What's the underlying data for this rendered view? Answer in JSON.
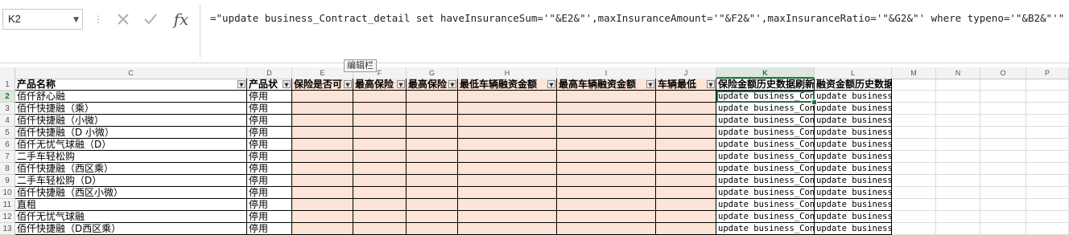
{
  "namebox": {
    "value": "K2"
  },
  "formula_bar": {
    "separator": "⋮",
    "insert_function_label": "fx",
    "formula": "=\"update business_Contract_detail set haveInsuranceSum='\"&E2&\"',maxInsuranceAmount='\"&F2&\"',maxInsuranceRatio='\"&G2&\"' where typeno='\"&B2&\"'\""
  },
  "tooltip": "编辑栏",
  "columns": [
    "C",
    "D",
    "E",
    "F",
    "G",
    "H",
    "I",
    "J",
    "K",
    "L",
    "M",
    "N",
    "O",
    "P"
  ],
  "active_column": "K",
  "row_numbers": [
    "1",
    "2",
    "3",
    "4",
    "5",
    "6",
    "7",
    "8",
    "9",
    "10",
    "11",
    "12",
    "13"
  ],
  "headers": {
    "C": "产品名称",
    "D": "产品状",
    "E": "保险是否可",
    "F": "最高保险",
    "G": "最高保险",
    "H": "最低车辆融资金额",
    "I": "最高车辆融资金额",
    "J": "车辆最低",
    "K": "保险金额历史数据刷新",
    "L": "融资金额历史数据刷新"
  },
  "rows": [
    {
      "C": "佰仟舒心融",
      "D": "停用",
      "K": "update business_Contract_detail set",
      "L": "update business_Contract_detail set"
    },
    {
      "C": "佰仟快捷融（乘）",
      "D": "停用",
      "K": "update business_Contract_detail set",
      "L": "update business_Contract_detail set"
    },
    {
      "C": "佰仟快捷融（小微）",
      "D": "停用",
      "K": "update business_Contract_detail set",
      "L": "update business_Contract_detail set"
    },
    {
      "C": "佰仟快捷融（D 小微）",
      "D": "停用",
      "K": "update business_Contract_detail set",
      "L": "update business_Contract_detail set"
    },
    {
      "C": "佰仟无忧气球融（D）",
      "D": "停用",
      "K": "update business_Contract_detail set",
      "L": "update business_Contract_detail set"
    },
    {
      "C": "二手车轻松购",
      "D": "停用",
      "K": "update business_Contract_detail set",
      "L": "update business_Contract_detail set"
    },
    {
      "C": "佰仟快捷融（西区乘）",
      "D": "停用",
      "K": "update business_Contract_detail set",
      "L": "update business_Contract_detail set"
    },
    {
      "C": "二手车轻松购（D）",
      "D": "停用",
      "K": "update business_Contract_detail set",
      "L": "update business_Contract_detail set"
    },
    {
      "C": "佰仟快捷融（西区小微）",
      "D": "停用",
      "K": "update business_Contract_detail set",
      "L": "update business_Contract_detail set"
    },
    {
      "C": "直租",
      "D": "停用",
      "K": "update business_Contract_detail set",
      "L": "update business_Contract_detail set"
    },
    {
      "C": "佰仟无忧气球融",
      "D": "停用",
      "K": "update business_Contract_detail set",
      "L": "update business_Contract_detail set"
    },
    {
      "C": "佰仟快捷融（D西区乘）",
      "D": "停用",
      "K": "update business_Contract_detail set",
      "L": "update business_Contract_detail set"
    }
  ],
  "colors": {
    "accent": "#217346",
    "peach": "#fce4d6"
  }
}
